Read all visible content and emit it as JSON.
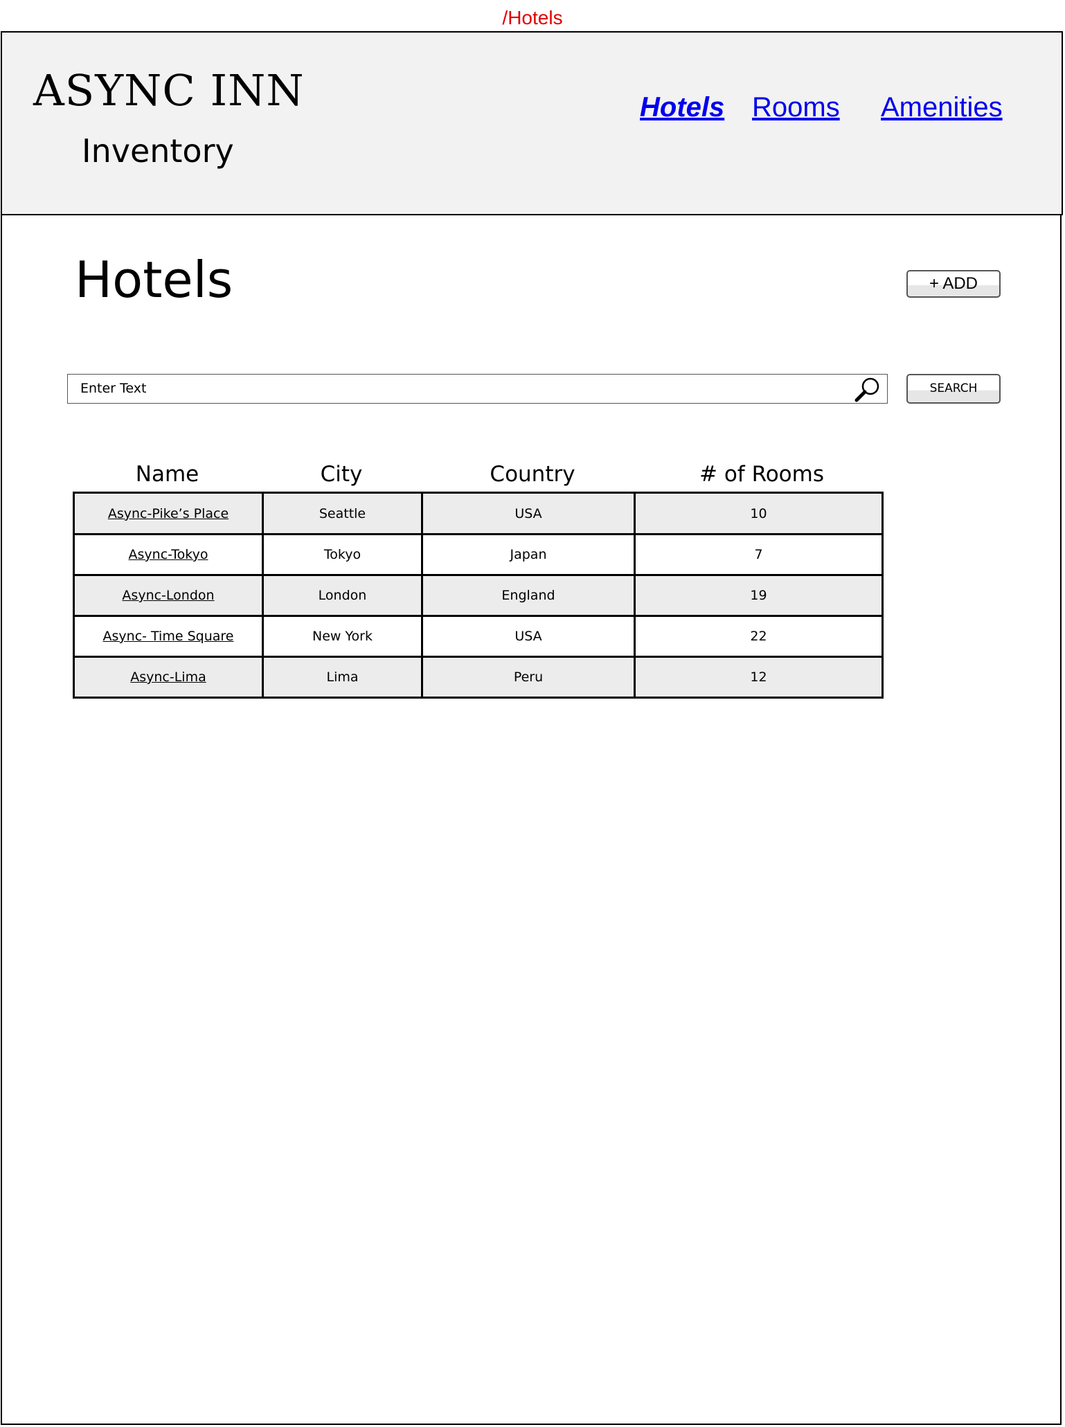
{
  "route": "/Hotels",
  "brand": {
    "title": "ASYNC INN",
    "subtitle": "Inventory"
  },
  "nav": {
    "hotels": "Hotels",
    "rooms": "Rooms",
    "amenities": "Amenities",
    "active": "hotels"
  },
  "page": {
    "title": "Hotels",
    "add_label": "+ ADD"
  },
  "search": {
    "placeholder": "Enter Text",
    "button_label": "SEARCH"
  },
  "table": {
    "columns": [
      "Name",
      "City",
      "Country",
      "# of Rooms"
    ],
    "rows": [
      {
        "name": "Async-Pike’s Place",
        "city": "Seattle",
        "country": "USA",
        "rooms": "10"
      },
      {
        "name": "Async-Tokyo",
        "city": "Tokyo",
        "country": "Japan",
        "rooms": "7"
      },
      {
        "name": "Async-London",
        "city": "London",
        "country": "England",
        "rooms": "19"
      },
      {
        "name": "Async- Time Square",
        "city": "New York",
        "country": "USA",
        "rooms": "22"
      },
      {
        "name": "Async-Lima",
        "city": "Lima",
        "country": "Peru",
        "rooms": "12"
      }
    ]
  },
  "colors": {
    "route": "#e00000",
    "header_bg": "#f2f2f2",
    "nav_link": "#0000ee",
    "row_shaded": "#ececec"
  }
}
